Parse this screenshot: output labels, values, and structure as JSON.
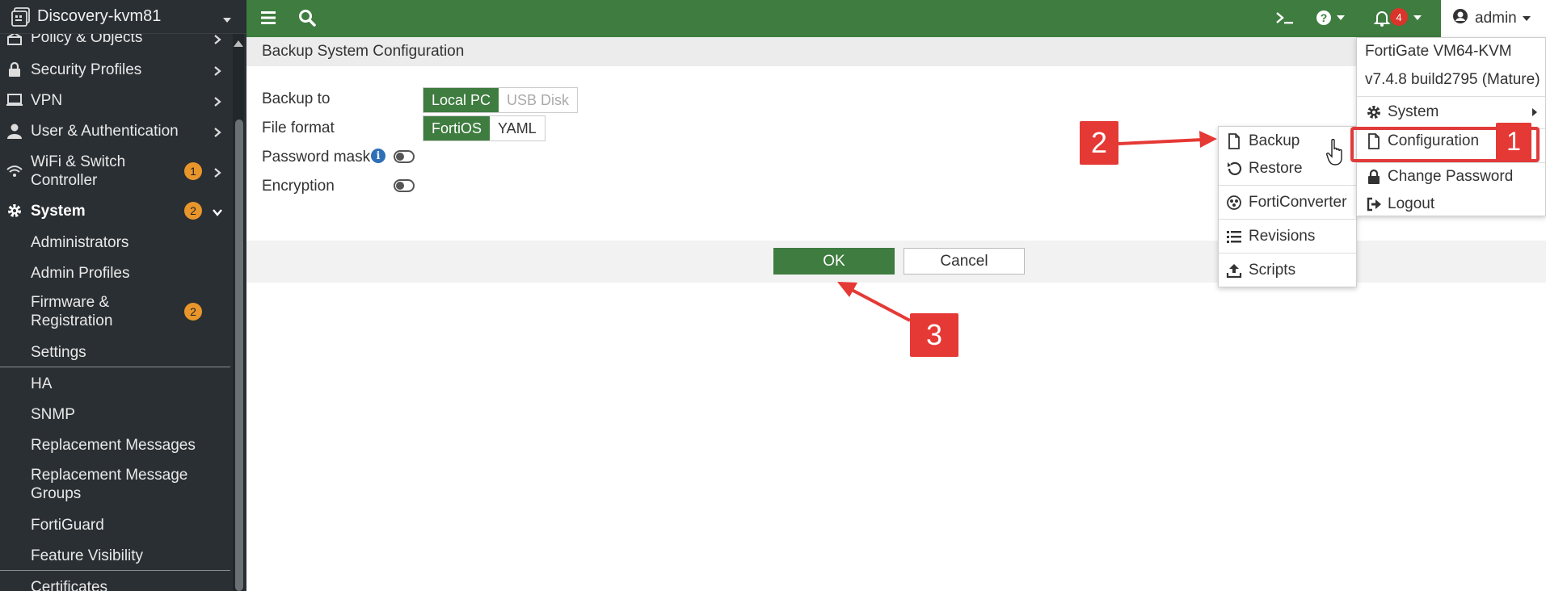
{
  "sidebar": {
    "device_name": "Discovery-kvm81",
    "items": [
      {
        "label": "Policy & Objects",
        "icon": "policy-icon"
      },
      {
        "label": "Security Profiles",
        "icon": "lock-icon"
      },
      {
        "label": "VPN",
        "icon": "monitor-icon"
      },
      {
        "label": "User & Authentication",
        "icon": "user-icon"
      },
      {
        "label": "WiFi & Switch",
        "label2": "Controller",
        "icon": "wifi-icon",
        "badge": "1"
      },
      {
        "label": "System",
        "icon": "gear-icon",
        "badge": "2"
      }
    ],
    "system_children": [
      {
        "label": "Administrators"
      },
      {
        "label": "Admin Profiles"
      },
      {
        "label": "Firmware &",
        "label2": "Registration",
        "badge": "2"
      },
      {
        "label": "Settings"
      },
      {
        "label": "HA"
      },
      {
        "label": "SNMP"
      },
      {
        "label": "Replacement Messages"
      },
      {
        "label": "Replacement Message",
        "label2": "Groups"
      },
      {
        "label": "FortiGuard"
      },
      {
        "label": "Feature Visibility"
      },
      {
        "label": "Certificates"
      }
    ]
  },
  "topbar": {
    "notification_count": "4",
    "admin_label": "admin",
    "accent_color": "#3e7c3f"
  },
  "page": {
    "title": "Backup System Configuration",
    "backup_to_label": "Backup to",
    "backup_to_options": [
      "Local PC",
      "USB Disk"
    ],
    "file_format_label": "File format",
    "file_format_options": [
      "FortiOS",
      "YAML"
    ],
    "password_mask_label": "Password mask",
    "encryption_label": "Encryption",
    "ok_label": "OK",
    "cancel_label": "Cancel"
  },
  "admin_menu": {
    "model": "FortiGate VM64-KVM",
    "version": "v7.4.8 build2795 (Mature)",
    "items": [
      {
        "label": "System",
        "icon": "gear-icon"
      },
      {
        "label": "Configuration",
        "icon": "file-icon"
      },
      {
        "label": "Change Password",
        "icon": "lock-icon"
      },
      {
        "label": "Logout",
        "icon": "logout-icon"
      }
    ]
  },
  "config_submenu": {
    "items": [
      {
        "label": "Backup",
        "icon": "file-icon"
      },
      {
        "label": "Restore",
        "icon": "restore-icon"
      },
      {
        "label": "FortiConverter",
        "icon": "forticonverter-icon"
      },
      {
        "label": "Revisions",
        "icon": "list-icon"
      },
      {
        "label": "Scripts",
        "icon": "upload-icon"
      }
    ]
  },
  "annotations": {
    "step1": "1",
    "step2": "2",
    "step3": "3",
    "color": "#e53935"
  }
}
